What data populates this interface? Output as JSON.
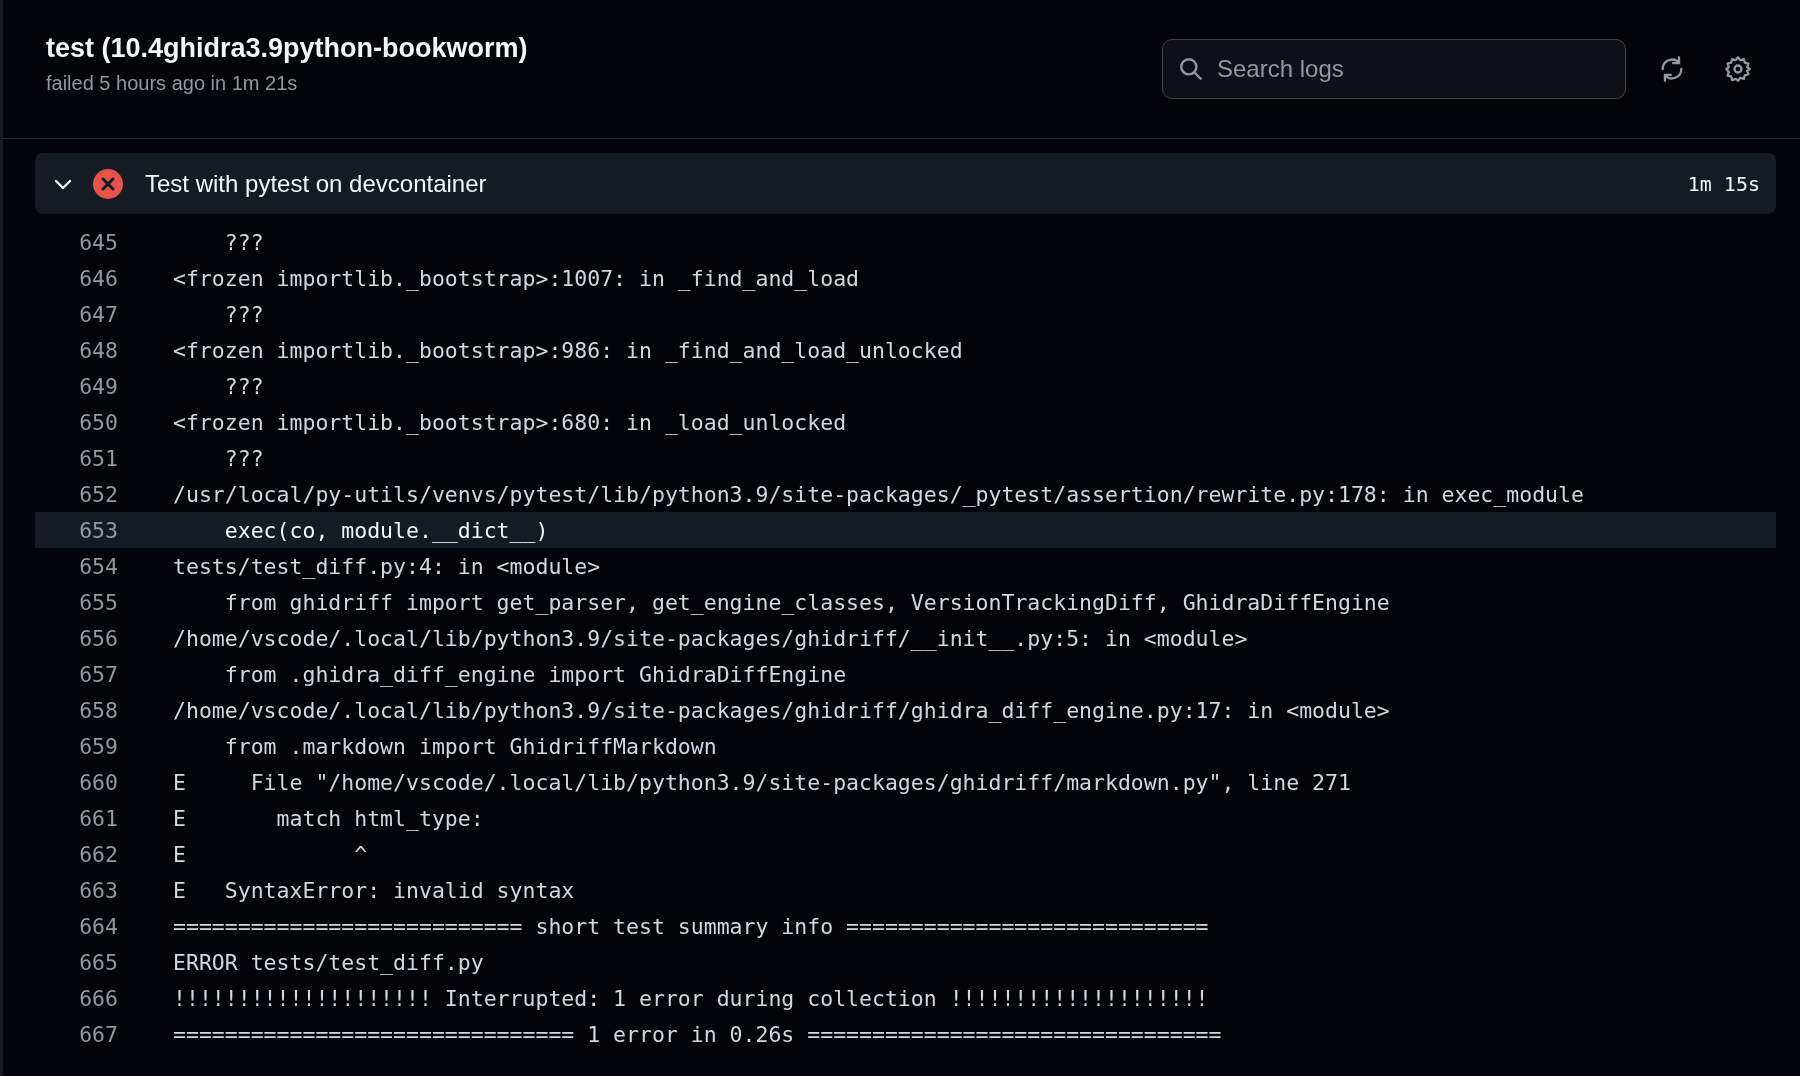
{
  "job": {
    "title": "test (10.4ghidra3.9python-bookworm)",
    "subtitle": "failed 5 hours ago in 1m 21s"
  },
  "search": {
    "placeholder": "Search logs"
  },
  "step": {
    "name": "Test with pytest on devcontainer",
    "duration": "1m 15s",
    "expanded": true,
    "failed": true
  },
  "lines": [
    {
      "number": "645",
      "text": "    ???",
      "selected": false
    },
    {
      "number": "646",
      "text": "<frozen importlib._bootstrap>:1007: in _find_and_load",
      "selected": false
    },
    {
      "number": "647",
      "text": "    ???",
      "selected": false
    },
    {
      "number": "648",
      "text": "<frozen importlib._bootstrap>:986: in _find_and_load_unlocked",
      "selected": false
    },
    {
      "number": "649",
      "text": "    ???",
      "selected": false
    },
    {
      "number": "650",
      "text": "<frozen importlib._bootstrap>:680: in _load_unlocked",
      "selected": false
    },
    {
      "number": "651",
      "text": "    ???",
      "selected": false
    },
    {
      "number": "652",
      "text": "/usr/local/py-utils/venvs/pytest/lib/python3.9/site-packages/_pytest/assertion/rewrite.py:178: in exec_module",
      "selected": false
    },
    {
      "number": "653",
      "text": "    exec(co, module.__dict__)",
      "selected": true
    },
    {
      "number": "654",
      "text": "tests/test_diff.py:4: in <module>",
      "selected": false
    },
    {
      "number": "655",
      "text": "    from ghidriff import get_parser, get_engine_classes, VersionTrackingDiff, GhidraDiffEngine",
      "selected": false
    },
    {
      "number": "656",
      "text": "/home/vscode/.local/lib/python3.9/site-packages/ghidriff/__init__.py:5: in <module>",
      "selected": false
    },
    {
      "number": "657",
      "text": "    from .ghidra_diff_engine import GhidraDiffEngine",
      "selected": false
    },
    {
      "number": "658",
      "text": "/home/vscode/.local/lib/python3.9/site-packages/ghidriff/ghidra_diff_engine.py:17: in <module>",
      "selected": false
    },
    {
      "number": "659",
      "text": "    from .markdown import GhidriffMarkdown",
      "selected": false
    },
    {
      "number": "660",
      "text": "E     File \"/home/vscode/.local/lib/python3.9/site-packages/ghidriff/markdown.py\", line 271",
      "selected": false
    },
    {
      "number": "661",
      "text": "E       match html_type:",
      "selected": false
    },
    {
      "number": "662",
      "text": "E             ^",
      "selected": false
    },
    {
      "number": "663",
      "text": "E   SyntaxError: invalid syntax",
      "selected": false
    },
    {
      "number": "664",
      "text": "=========================== short test summary info ============================",
      "selected": false
    },
    {
      "number": "665",
      "text": "ERROR tests/test_diff.py",
      "selected": false
    },
    {
      "number": "666",
      "text": "!!!!!!!!!!!!!!!!!!!! Interrupted: 1 error during collection !!!!!!!!!!!!!!!!!!!!",
      "selected": false
    },
    {
      "number": "667",
      "text": "=============================== 1 error in 0.26s ================================",
      "selected": false
    }
  ]
}
